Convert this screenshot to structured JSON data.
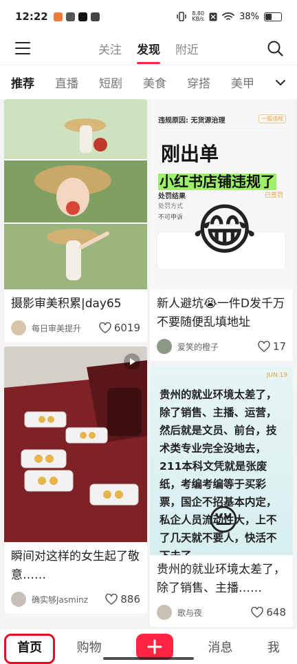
{
  "status_bar": {
    "time": "12:22",
    "net_speed_value": "8.80",
    "net_speed_unit": "KB/s",
    "battery": "38%",
    "battery_level": 0.38
  },
  "top_nav": {
    "tabs": [
      {
        "label": "关注",
        "active": false
      },
      {
        "label": "发现",
        "active": true
      },
      {
        "label": "附近",
        "active": false
      }
    ]
  },
  "categories": [
    {
      "label": "推荐",
      "active": true
    },
    {
      "label": "直播",
      "active": false
    },
    {
      "label": "短剧",
      "active": false
    },
    {
      "label": "美食",
      "active": false
    },
    {
      "label": "穿搭",
      "active": false
    },
    {
      "label": "美甲",
      "active": false
    }
  ],
  "feed": {
    "left": [
      {
        "title": "摄影审美积累|day65",
        "author": "每日审美提升",
        "likes": "6019"
      },
      {
        "title": "瞬间对这样的女生起了敬意……",
        "author": "确实够Jasminz",
        "likes": "886"
      }
    ],
    "right": [
      {
        "overlay_line1": "刚出单",
        "overlay_line2": "小红书店铺违规了",
        "screenshot_heading": "违规原因: 无货源治理",
        "screenshot_tag": "一般违规",
        "screenshot_label1": "处罚结果",
        "screenshot_label2": "处罚方式",
        "screenshot_label3": "不可申诉",
        "screenshot_status": "已签罚",
        "title": "新人避坑😭一件D发千万不要随便乱填地址",
        "author": "爱笑的橙子",
        "likes": "17"
      },
      {
        "date": "JUN.19",
        "body": "贵州的就业环境太差了，除了销售、主播、运营，然后就是文员、前台，技术类专业完全没地去，211本科文凭就是张废纸，考编考编等于买彩票，国企不招基本内定，私企人员流动性大，上不了几天就不要人，快活不下去了",
        "title": "贵州的就业环境太差了，除了销售、主播……",
        "author": "歌与夜",
        "likes": "648"
      }
    ]
  },
  "bottom_nav": {
    "home": "首页",
    "shop": "购物",
    "messages": "消息",
    "me": "我"
  },
  "colors": {
    "accent": "#ff2442",
    "highlight": "#9ef06b"
  }
}
